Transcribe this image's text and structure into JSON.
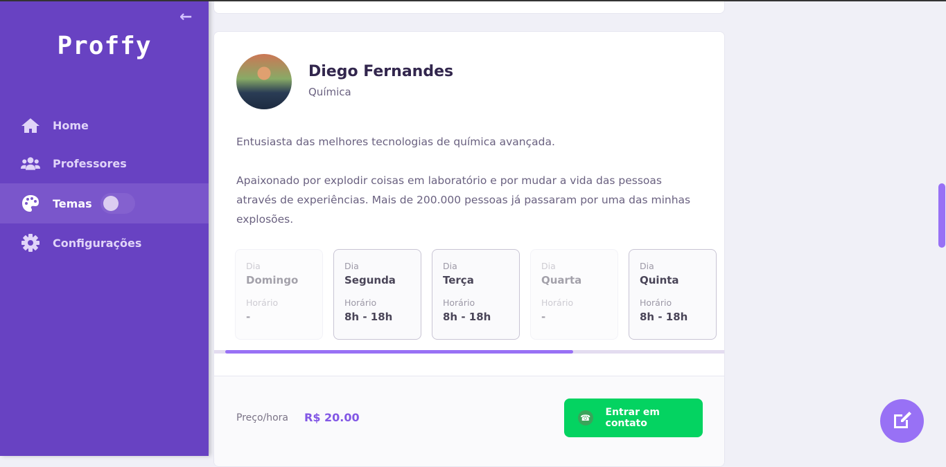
{
  "sidebar": {
    "logo": "Proffy",
    "items": [
      {
        "label": "Home",
        "icon": "home-icon"
      },
      {
        "label": "Professores",
        "icon": "users-icon"
      },
      {
        "label": "Temas",
        "icon": "palette-icon",
        "toggle_on": false
      },
      {
        "label": "Configurações",
        "icon": "gear-icon"
      }
    ]
  },
  "teacher": {
    "name": "Diego Fernandes",
    "subject": "Química",
    "bio": [
      "Entusiasta das melhores tecnologias de química avançada.",
      "Apaixonado por explodir coisas em laboratório e por mudar a vida das pessoas através de experiências. Mais de 200.000 pessoas já passaram por uma das minhas explosões."
    ]
  },
  "schedule": {
    "day_label": "Dia",
    "time_label": "Horário",
    "days": [
      {
        "day": "Domingo",
        "time": "-"
      },
      {
        "day": "Segunda",
        "time": "8h - 18h"
      },
      {
        "day": "Terça",
        "time": "8h - 18h"
      },
      {
        "day": "Quarta",
        "time": "-"
      },
      {
        "day": "Quinta",
        "time": "8h - 18h"
      }
    ],
    "scroll_progress": 0.68
  },
  "footer": {
    "price_label": "Preço/hora",
    "price": "R$ 20.00",
    "contact_label": "Entrar em contato"
  },
  "colors": {
    "primary": "#8257e5",
    "sidebar": "#6842c2",
    "green": "#04d361"
  }
}
